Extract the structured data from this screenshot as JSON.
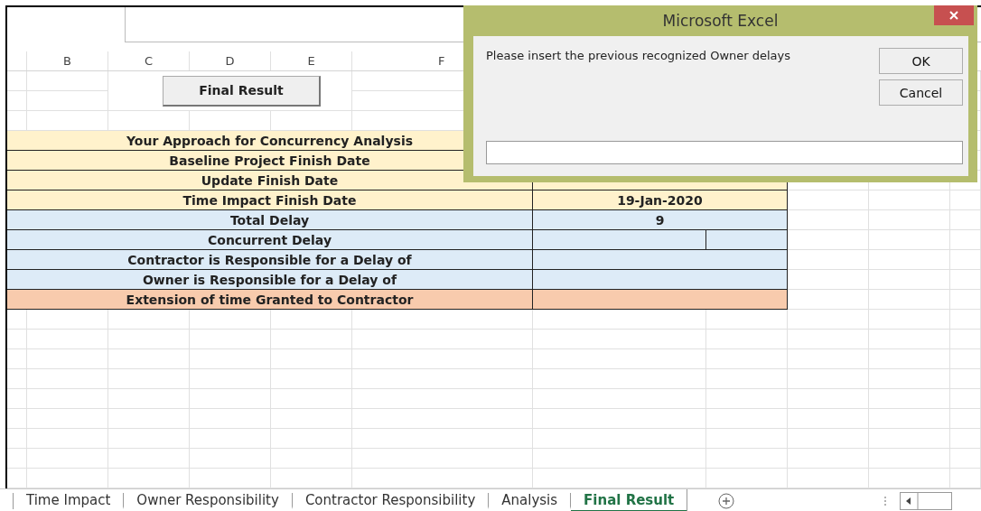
{
  "column_headers": [
    "B",
    "C",
    "D",
    "E",
    "F"
  ],
  "sheet_button": {
    "label": "Final Result"
  },
  "summary_rows": [
    {
      "label": "Your Approach for Concurrency Analysis",
      "color": "#fff2cc",
      "kind": "single"
    },
    {
      "label": "Baseline Project Finish Date",
      "color": "#fff2cc",
      "kind": "single"
    },
    {
      "label": "Update Finish Date",
      "color": "#fff2cc",
      "kind": "single"
    },
    {
      "label": "Time Impact Finish Date",
      "value": "19-Jan-2020",
      "color": "#fff2cc",
      "kind": "single"
    },
    {
      "label": "Total Delay",
      "value": "9",
      "color": "#ddebf7",
      "kind": "single"
    },
    {
      "label": "Concurrent Delay",
      "color": "#ddebf7",
      "kind": "split"
    },
    {
      "label": "Contractor is  Responsible for a Delay of",
      "color": "#ddebf7",
      "kind": "single"
    },
    {
      "label": "Owner is  Responsible for a Delay of",
      "color": "#ddebf7",
      "kind": "single"
    },
    {
      "label": "Extension of time Granted to Contractor",
      "color": "#f8cbad",
      "kind": "single"
    }
  ],
  "sheet_tabs": [
    {
      "label": "Time Impact",
      "selected": false
    },
    {
      "label": "Owner Responsibility",
      "selected": false
    },
    {
      "label": "Contractor Responsibility",
      "selected": false
    },
    {
      "label": "Analysis",
      "selected": false
    },
    {
      "label": "Final Result",
      "selected": true
    }
  ],
  "dialog": {
    "title": "Microsoft Excel",
    "message": "Please insert the previous recognized Owner delays",
    "buttons": [
      "OK",
      "Cancel"
    ]
  }
}
